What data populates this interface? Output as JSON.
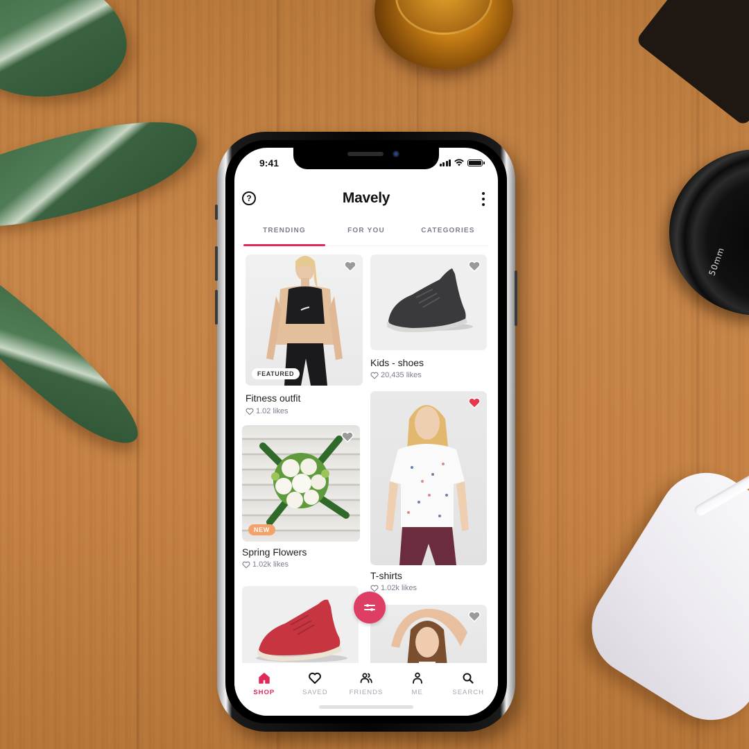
{
  "status_bar": {
    "time": "9:41",
    "battery_level": 1.0,
    "signal_bars": 4
  },
  "header": {
    "title": "Mavely",
    "help_icon": "question-circle-icon",
    "more_icon": "vertical-ellipsis-icon"
  },
  "tabs": [
    {
      "label": "TRENDING",
      "active": true
    },
    {
      "label": "FOR YOU",
      "active": false
    },
    {
      "label": "CATEGORIES",
      "active": false
    }
  ],
  "products": [
    {
      "title": "Fitness outfit",
      "likes": "1.02 likes",
      "badge": "FEATURED",
      "liked": false,
      "image": "woman-sports-bra-leggings"
    },
    {
      "title": "Kids - shoes",
      "likes": "20,435 likes",
      "badge": null,
      "liked": false,
      "image": "charcoal-wool-sneaker"
    },
    {
      "title": "Spring Flowers",
      "likes": "1.02k likes",
      "badge": "NEW",
      "liked": false,
      "image": "white-rose-bouquet"
    },
    {
      "title": "T-shirts",
      "likes": "1.02k likes",
      "badge": null,
      "liked": true,
      "image": "woman-printed-tshirt"
    },
    {
      "title": "",
      "likes": "",
      "badge": null,
      "liked": false,
      "image": "red-wool-sneaker"
    },
    {
      "title": "",
      "likes": "",
      "badge": null,
      "liked": false,
      "image": "woman-arms-raised"
    }
  ],
  "fab": {
    "icon": "filter-sliders-icon"
  },
  "tabbar": [
    {
      "label": "SHOP",
      "icon": "home-icon",
      "active": true
    },
    {
      "label": "SAVED",
      "icon": "heart-icon",
      "active": false
    },
    {
      "label": "FRIENDS",
      "icon": "friends-icon",
      "active": false
    },
    {
      "label": "ME",
      "icon": "person-icon",
      "active": false
    },
    {
      "label": "SEARCH",
      "icon": "search-icon",
      "active": false
    }
  ],
  "colors": {
    "accent": "#e0285a",
    "fab": "#de3d64",
    "tab_inactive": "#7a7d8c",
    "heart_liked": "#e8374a",
    "heart_default": "#9a9a9a",
    "badge_new": "#f4a26b"
  },
  "background": {
    "lens_text": "50mm"
  }
}
